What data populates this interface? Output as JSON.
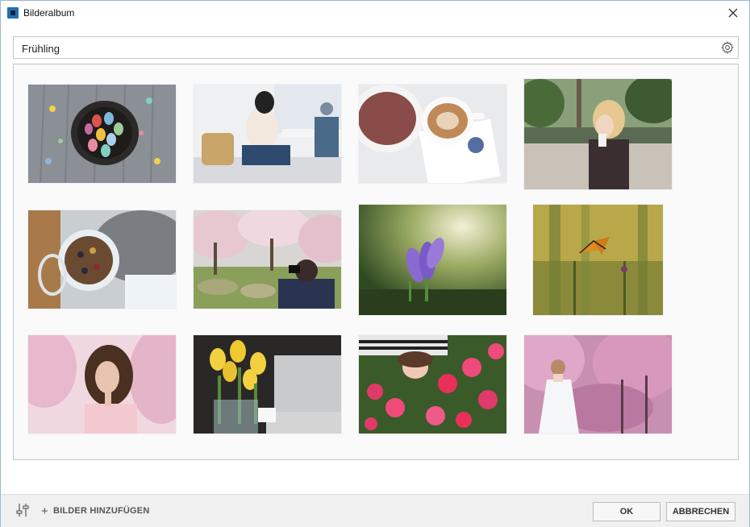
{
  "window": {
    "title": "Bilderalbum"
  },
  "search": {
    "value": "Frühling"
  },
  "photos": [
    {
      "subject": "easter-eggs-basket"
    },
    {
      "subject": "woman-in-cafe"
    },
    {
      "subject": "coffee-and-granola"
    },
    {
      "subject": "woman-with-coffee-street"
    },
    {
      "subject": "jar-of-muesli"
    },
    {
      "subject": "photographer-in-blossom-park"
    },
    {
      "subject": "purple-crocus"
    },
    {
      "subject": "butterfly-on-plant"
    },
    {
      "subject": "woman-in-pink-blossoms"
    },
    {
      "subject": "tulips-and-laptop"
    },
    {
      "subject": "woman-in-flower-bed"
    },
    {
      "subject": "bride-in-blossom-garden"
    }
  ],
  "footer": {
    "add_images_label": "BILDER HINZUFÜGEN",
    "ok_label": "OK",
    "cancel_label": "ABBRECHEN"
  }
}
